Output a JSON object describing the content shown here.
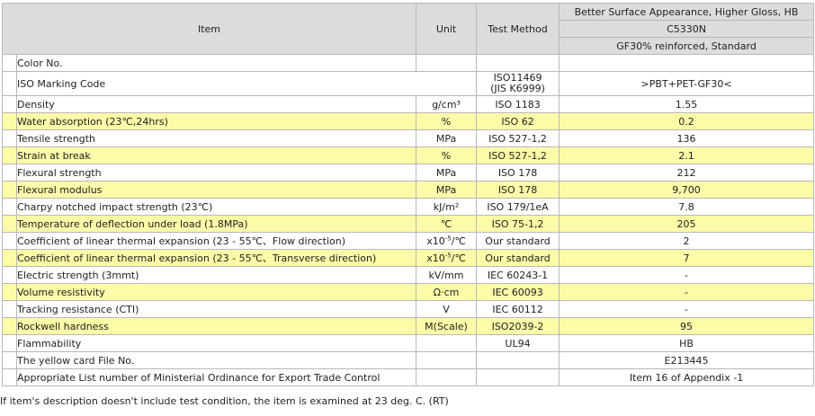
{
  "header": {
    "item": "Item",
    "unit": "Unit",
    "test_method": "Test Method",
    "grade_title": "Better Surface Appearance, Higher Gloss, HB",
    "grade_code": "C5330N",
    "grade_desc": "GF30% reinforced, Standard"
  },
  "colors": {
    "header_bg": "#dcdcdc",
    "highlight_row": "#fbfba8",
    "border": "#b8b8b8"
  },
  "rows": [
    {
      "item": "Color No.",
      "unit": "",
      "method": "",
      "value": ""
    },
    {
      "item": "ISO Marking Code",
      "unit": "",
      "method_line1": "ISO11469",
      "method_line2": "(JIS K6999)",
      "value": ">PBT+PET-GF30<"
    },
    {
      "item": "Density",
      "unit": "g/cm³",
      "method": "ISO 1183",
      "value": "1.55"
    },
    {
      "item": "Water absorption (23℃,24hrs)",
      "unit": "%",
      "method": "ISO 62",
      "value": "0.2"
    },
    {
      "item": "Tensile strength",
      "unit": "MPa",
      "method": "ISO 527-1,2",
      "value": "136"
    },
    {
      "item": "Strain at break",
      "unit": "%",
      "method": "ISO 527-1,2",
      "value": "2.1"
    },
    {
      "item": "Flexural strength",
      "unit": "MPa",
      "method": "ISO 178",
      "value": "212"
    },
    {
      "item": "Flexural modulus",
      "unit": "MPa",
      "method": "ISO 178",
      "value": "9,700"
    },
    {
      "item": "Charpy notched impact strength (23℃)",
      "unit": "kJ/m²",
      "method": "ISO 179/1eA",
      "value": "7.8"
    },
    {
      "item": "Temperature of deflection under load (1.8MPa)",
      "unit": "℃",
      "method": "ISO 75-1,2",
      "value": "205"
    },
    {
      "item": "Coefficient of linear thermal expansion (23 - 55℃、Flow direction)",
      "unit_base": "x10",
      "unit_exp": "-5",
      "unit_suffix": "/℃",
      "method": "Our standard",
      "value": "2"
    },
    {
      "item": "Coefficient of linear thermal expansion (23 - 55℃、Transverse direction)",
      "unit_base": "x10",
      "unit_exp": "-5",
      "unit_suffix": "/℃",
      "method": "Our standard",
      "value": "7"
    },
    {
      "item": "Electric strength (3mmt)",
      "unit": "kV/mm",
      "method": "IEC 60243-1",
      "value": "-"
    },
    {
      "item": "Volume resistivity",
      "unit": "Ω·cm",
      "method": "IEC 60093",
      "value": "-"
    },
    {
      "item": "Tracking resistance (CTI)",
      "unit": "V",
      "method": "IEC 60112",
      "value": "-"
    },
    {
      "item": "Rockwell hardness",
      "unit": "M(Scale)",
      "method": "ISO2039-2",
      "value": "95"
    },
    {
      "item": "Flammability",
      "unit": "",
      "method": "UL94",
      "value": "HB"
    },
    {
      "item": "The yellow card File No.",
      "unit": "",
      "method": "",
      "value": "E213445"
    },
    {
      "item": "Appropriate List number of Ministerial Ordinance for Export Trade Control",
      "unit": "",
      "method": "",
      "value": "Item 16 of Appendix -1"
    }
  ],
  "footnote": "If item's description doesn't include test condition, the item is examined at 23 deg. C. (RT)"
}
